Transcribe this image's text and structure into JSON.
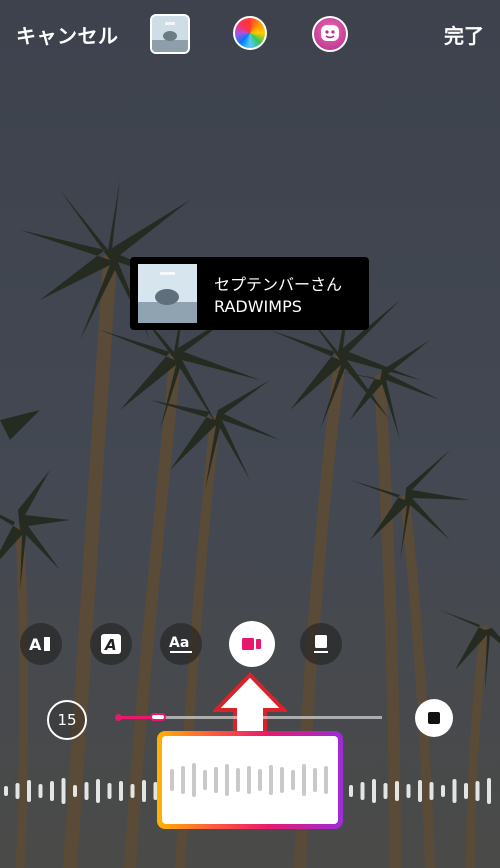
{
  "topbar": {
    "cancel_label": "キャンセル",
    "done_label": "完了",
    "thumbnail_icon": "album-thumbnail-icon",
    "color_icon": "color-wheel-icon",
    "sticker_icon": "sticker-face-icon"
  },
  "music_sticker": {
    "title": "セプテンバーさん",
    "artist": "RADWIMPS",
    "art_icon": "album-art-icon"
  },
  "style_options": [
    {
      "label": "A▌",
      "icon": "lyrics-style-icon"
    },
    {
      "label": "A",
      "icon": "text-style-icon"
    },
    {
      "label": "Aa",
      "icon": "font-style-icon"
    },
    {
      "label": "",
      "icon": "music-card-icon",
      "selected": true
    },
    {
      "label": "",
      "icon": "album-only-icon"
    }
  ],
  "playback": {
    "duration_seconds": "15",
    "progress_fraction": 0.17,
    "stop_icon": "stop-icon"
  },
  "colors": {
    "accent": "#e8196d",
    "arrow_fill": "#ffffff",
    "arrow_stroke": "#d9222a",
    "card_bg": "#000000"
  }
}
